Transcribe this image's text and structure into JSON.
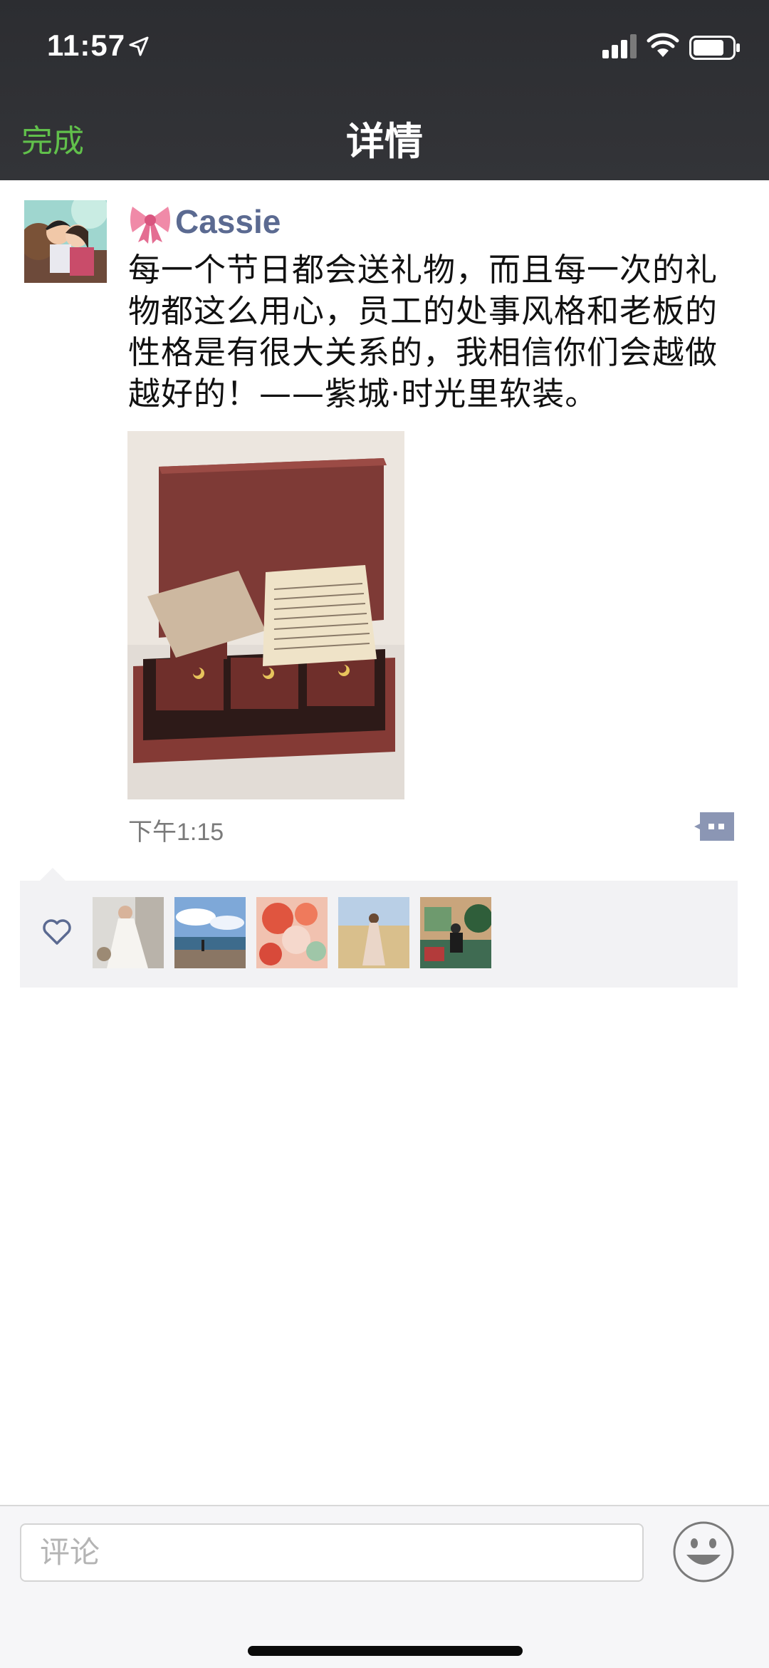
{
  "status_bar": {
    "time": "11:57"
  },
  "nav": {
    "done_label": "完成",
    "title": "详情"
  },
  "post": {
    "username": "Cassie",
    "text": "每一个节日都会送礼物，而且每一次的礼物都这么用心，员工的处事风格和老板的性格是有很大关系的，我相信你们会越做越好的！——紫城·时光里软装。",
    "time": "下午1:15"
  },
  "likes": {
    "count_shown": 5
  },
  "comment_bar": {
    "placeholder": "评论"
  },
  "colors": {
    "accent_green": "#61c04b",
    "username_blue": "#5b6a91",
    "nav_bg": "#2f3034",
    "likes_bg": "#f2f2f4"
  },
  "icons": [
    "location-arrow-icon",
    "signal-icon",
    "wifi-icon",
    "battery-icon",
    "bow-icon",
    "more-options-icon",
    "heart-icon",
    "emoji-icon"
  ]
}
